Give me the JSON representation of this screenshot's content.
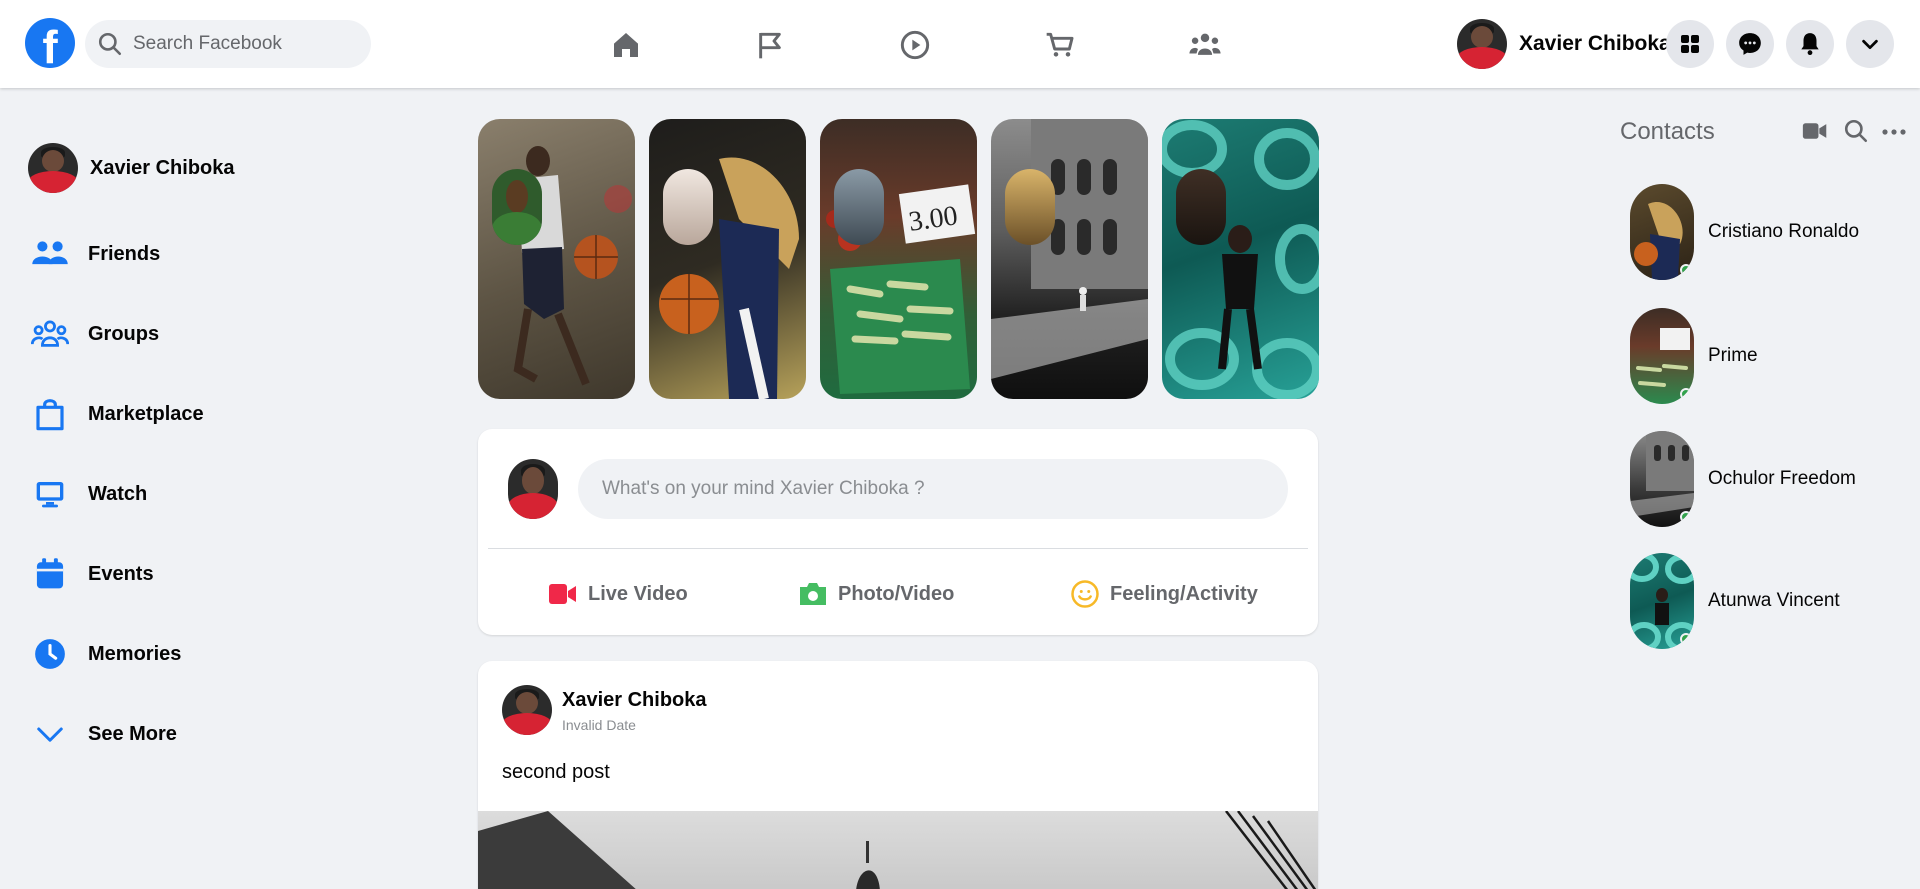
{
  "header": {
    "search_placeholder": "Search Facebook",
    "logo_letter": "f",
    "nav": [
      "home-icon",
      "flag-icon",
      "video-icon",
      "marketplace-icon",
      "groups-icon"
    ],
    "user_name": "Xavier Chiboka",
    "buttons": [
      "menu-grid-icon",
      "messenger-icon",
      "bell-icon",
      "chevron-down-icon"
    ]
  },
  "sidebar": {
    "profile_name": "Xavier Chiboka",
    "items": [
      {
        "label": "Friends",
        "icon": "friends-icon"
      },
      {
        "label": "Groups",
        "icon": "groups-icon"
      },
      {
        "label": "Marketplace",
        "icon": "shopping-bag-icon"
      },
      {
        "label": "Watch",
        "icon": "monitor-icon"
      },
      {
        "label": "Events",
        "icon": "calendar-icon"
      },
      {
        "label": "Memories",
        "icon": "clock-icon"
      },
      {
        "label": "See More",
        "icon": "chevron-down-icon"
      }
    ]
  },
  "composer": {
    "placeholder": "What's on your mind Xavier Chiboka ?",
    "live_video": "Live Video",
    "photo_video": "Photo/Video",
    "feeling": "Feeling/Activity"
  },
  "post": {
    "author": "Xavier Chiboka",
    "date": "Invalid Date",
    "text": "second post"
  },
  "contacts": {
    "title": "Contacts",
    "people": [
      {
        "name": "Cristiano Ronaldo"
      },
      {
        "name": "Prime"
      },
      {
        "name": "Ochulor Freedom"
      },
      {
        "name": "Atunwa Vincent"
      }
    ]
  },
  "colors": {
    "brand": "#1877f2",
    "background": "#f0f2f5",
    "live": "#f02849",
    "photo": "#45bd62",
    "feeling": "#f7b928"
  }
}
